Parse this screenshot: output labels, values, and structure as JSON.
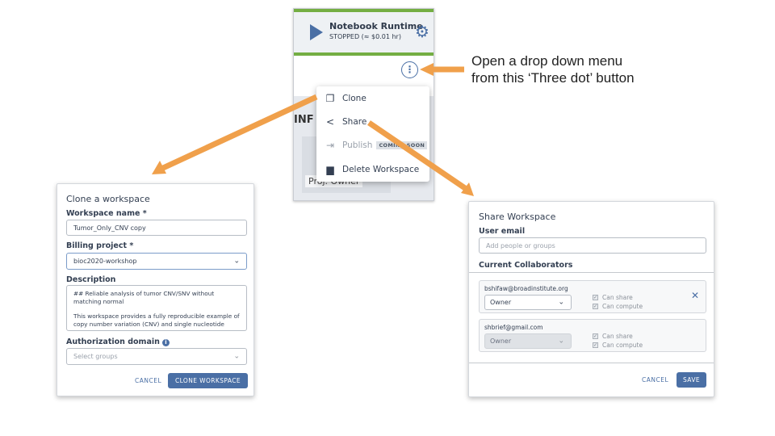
{
  "runtime": {
    "title": "Notebook Runtime",
    "status": "STOPPED (≈ $0.01 hr)",
    "info_label": "INF",
    "proj_owner": "Proj. Owner"
  },
  "menu": {
    "items": [
      {
        "label": "Clone",
        "icon": "clone-icon"
      },
      {
        "label": "Share",
        "icon": "share-icon"
      },
      {
        "label": "Publish",
        "icon": "publish-icon",
        "badge": "COMING SOON"
      },
      {
        "label": "Delete Workspace",
        "icon": "trash-icon"
      }
    ]
  },
  "annotation": {
    "line1": "Open a drop down menu",
    "line2": "from this ‘Three dot’ button"
  },
  "clone_dialog": {
    "title": "Clone a workspace",
    "name_label": "Workspace name *",
    "name_value": "Tumor_Only_CNV copy",
    "billing_label": "Billing project *",
    "billing_value": "bioc2020-workshop",
    "description_label": "Description",
    "description_line1": "## Reliable analysis of tumor CNV/SNV without matching normal",
    "description_line2": "This workspace provides a fully reproducible example of copy number variation (CNV) and single nucleotide",
    "auth_label": "Authorization domain",
    "auth_placeholder": "Select groups",
    "cancel": "CANCEL",
    "confirm": "CLONE WORKSPACE"
  },
  "share_dialog": {
    "title": "Share Workspace",
    "email_label": "User email",
    "email_placeholder": "Add people or groups",
    "collaborators_label": "Current Collaborators",
    "collaborators": [
      {
        "email": "bshifaw@broadinstitute.org",
        "role": "Owner",
        "can_share": "Can share",
        "can_compute": "Can compute"
      },
      {
        "email": "shbrief@gmail.com",
        "role": "Owner",
        "can_share": "Can share",
        "can_compute": "Can compute"
      }
    ],
    "cancel": "CANCEL",
    "save": "SAVE"
  },
  "colors": {
    "accent": "#4a6fa5",
    "arrow": "#f0a04b",
    "runtime_green": "#74ae43"
  }
}
